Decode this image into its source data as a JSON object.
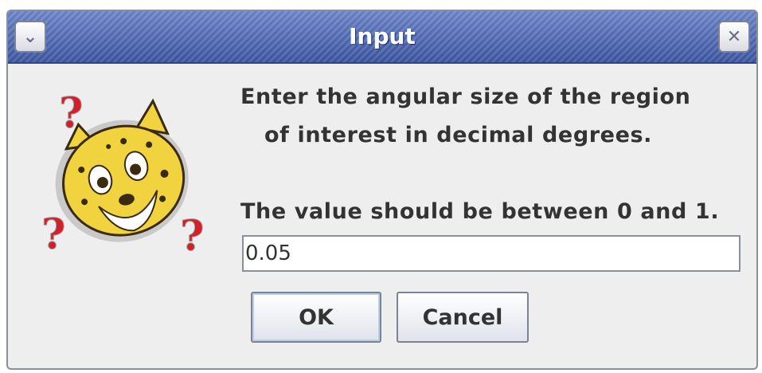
{
  "window": {
    "title": "Input",
    "menu_icon": "chevron-down-icon",
    "close_icon": "close-icon",
    "menu_glyph": "⌄",
    "close_glyph": "✕"
  },
  "dialog": {
    "icon": "cheetah-question-icon",
    "message_line1": "Enter the angular size of the region",
    "message_line2": "of interest in decimal degrees.",
    "message_line3": "The value should be between 0 and 1.",
    "input_value": "0.05"
  },
  "buttons": {
    "ok_label": "OK",
    "cancel_label": "Cancel"
  },
  "colors": {
    "titlebar": "#4a66b2",
    "dialog_bg": "#eeeeee",
    "selection": "#b8cfe5",
    "question_mark": "#d21f2a",
    "cheetah_fur": "#f1d23f"
  }
}
